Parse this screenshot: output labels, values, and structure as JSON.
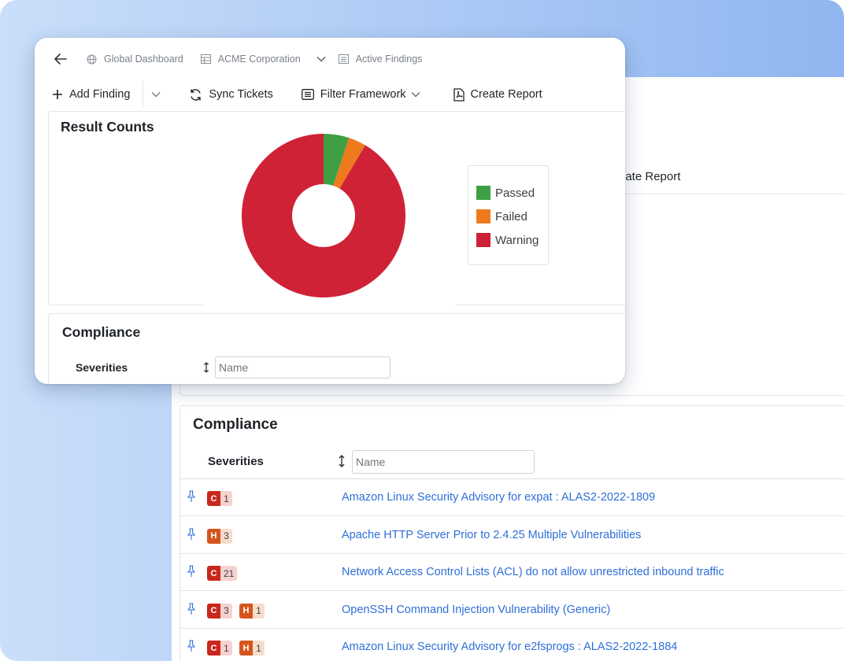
{
  "colors": {
    "passed": "#3ea043",
    "failed": "#ee7a1e",
    "warning": "#cf2236",
    "link": "#2f6fd8",
    "critical": "#c9271d",
    "high": "#d4551c"
  },
  "breadcrumb": {
    "items": [
      {
        "label": "Global Dashboard",
        "icon": "globe-icon"
      },
      {
        "label": "ACME Corporation",
        "icon": "table-icon"
      },
      {
        "label": "Active Findings",
        "icon": "list-icon"
      }
    ]
  },
  "toolbar": {
    "add_finding": "Add Finding",
    "sync_tickets": "Sync Tickets",
    "filter_framework": "Filter Framework",
    "create_report": "Create Report"
  },
  "back_toolbar": {
    "create_report_partial": "eate Report"
  },
  "result_counts": {
    "title": "Result Counts"
  },
  "chart_data": {
    "type": "pie",
    "donut": true,
    "title": "Result Counts",
    "legend_position": "right",
    "categories": [
      "Passed",
      "Failed",
      "Warning"
    ],
    "values": [
      5,
      3.5,
      91.5
    ],
    "colors": [
      "#3ea043",
      "#ee7a1e",
      "#cf2236"
    ]
  },
  "compliance": {
    "title": "Compliance",
    "severities_label": "Severities",
    "name_placeholder": "Name"
  },
  "findings": [
    {
      "badges": [
        {
          "level": "C",
          "count": "1",
          "type": "c"
        }
      ],
      "title": "Amazon Linux Security Advisory for expat : ALAS2-2022-1809"
    },
    {
      "badges": [
        {
          "level": "H",
          "count": "3",
          "type": "h"
        }
      ],
      "title": "Apache HTTP Server Prior to 2.4.25 Multiple Vulnerabilities"
    },
    {
      "badges": [
        {
          "level": "C",
          "count": "21",
          "type": "c"
        }
      ],
      "title": "Network Access Control Lists (ACL) do not allow unrestricted inbound traffic"
    },
    {
      "badges": [
        {
          "level": "C",
          "count": "3",
          "type": "c"
        },
        {
          "level": "H",
          "count": "1",
          "type": "h"
        }
      ],
      "title": "OpenSSH Command Injection Vulnerability (Generic)"
    },
    {
      "badges": [
        {
          "level": "C",
          "count": "1",
          "type": "c"
        },
        {
          "level": "H",
          "count": "1",
          "type": "h"
        }
      ],
      "title": "Amazon Linux Security Advisory for e2fsprogs : ALAS2-2022-1884"
    }
  ]
}
